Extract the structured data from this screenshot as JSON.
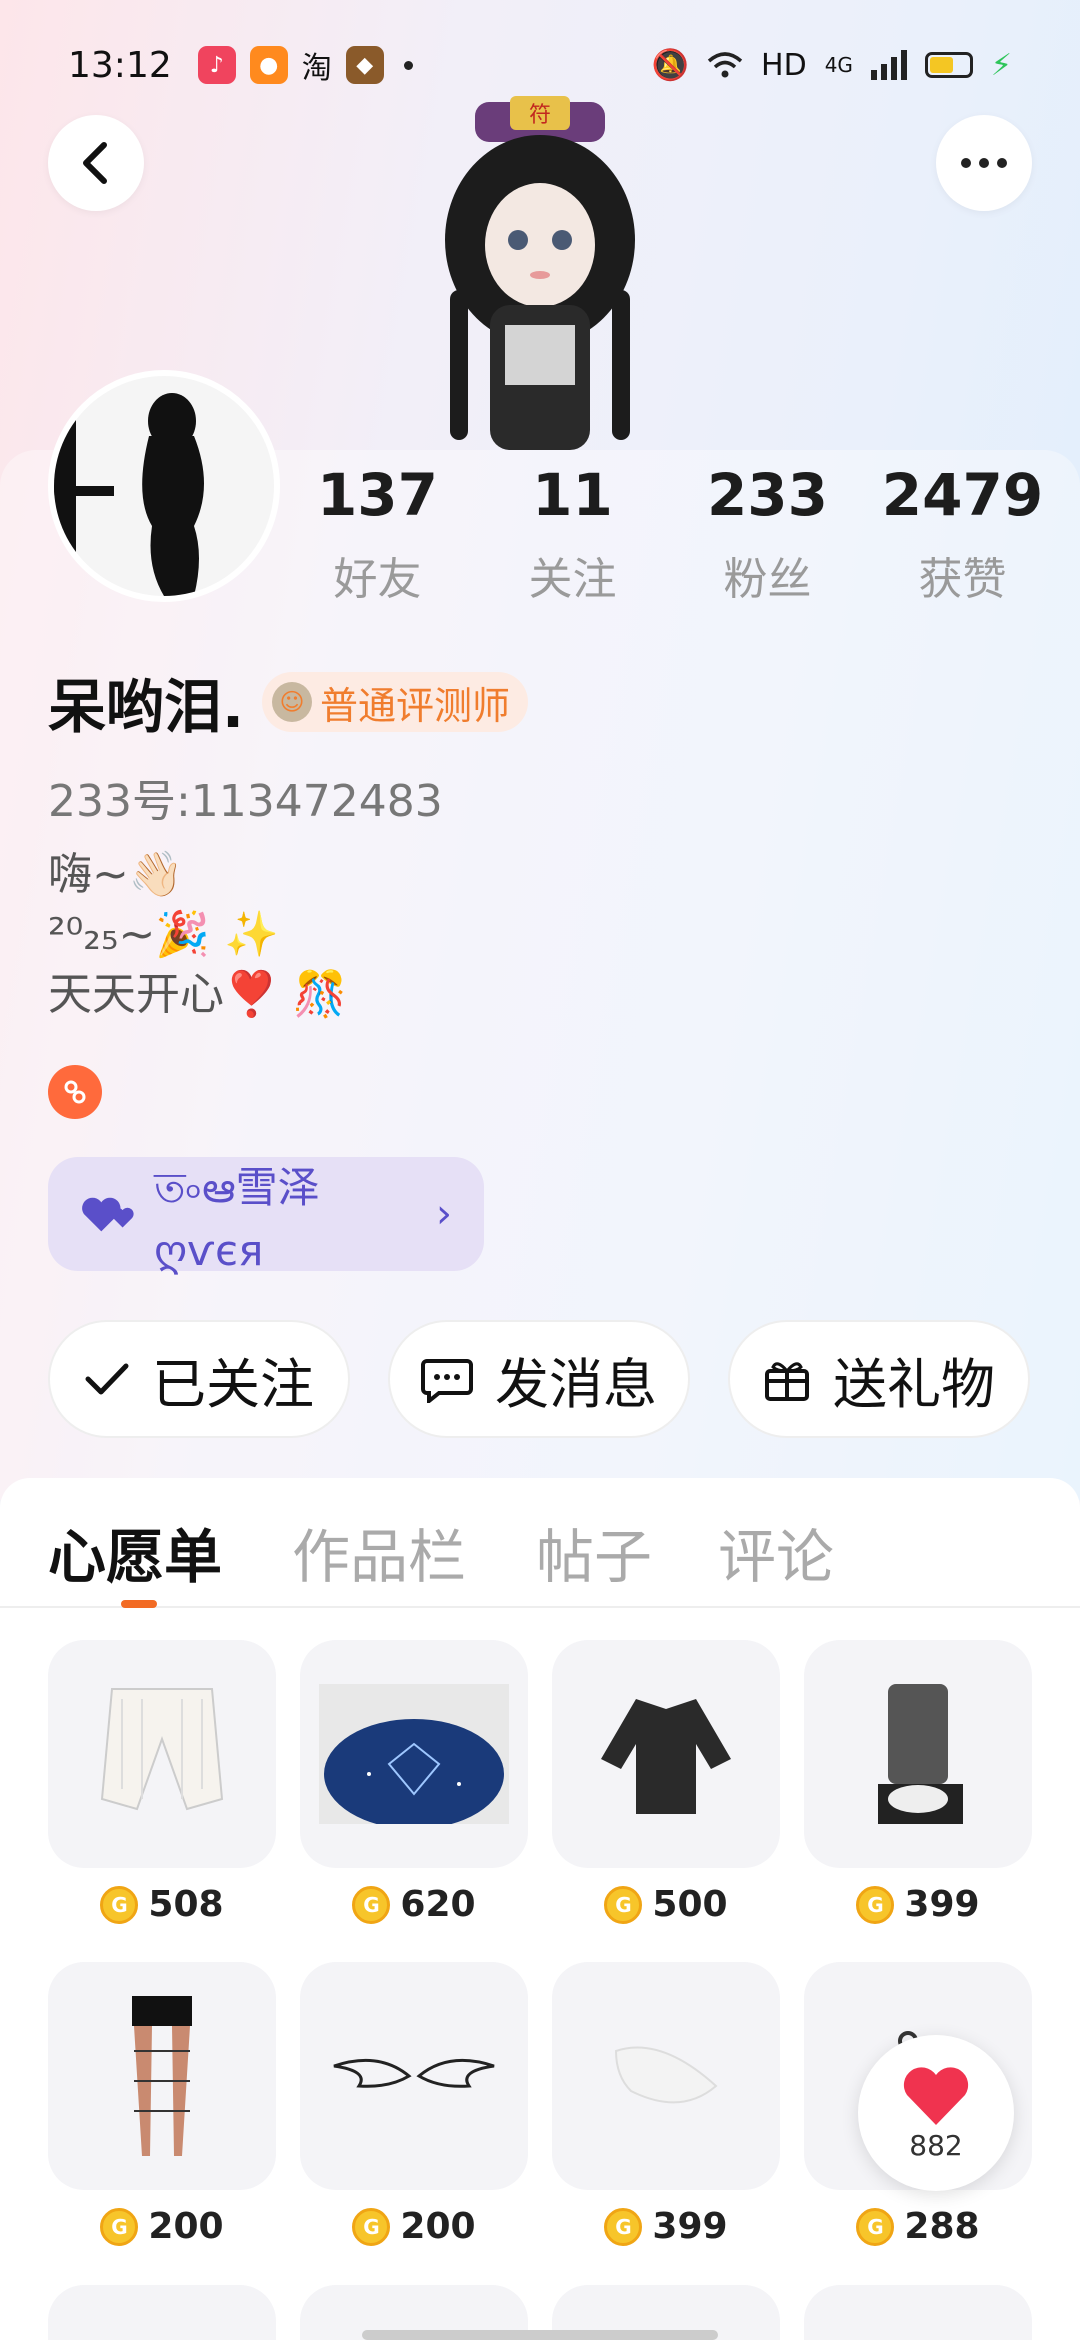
{
  "status_bar": {
    "time": "13:12",
    "network": "HD",
    "signal": "4G",
    "battery_color": "#f4c623",
    "taobao_label": "淘"
  },
  "profile": {
    "stats": [
      {
        "value": "137",
        "label": "好友"
      },
      {
        "value": "11",
        "label": "关注"
      },
      {
        "value": "233",
        "label": "粉丝"
      },
      {
        "value": "2479",
        "label": "获赞"
      }
    ],
    "name": "呆哟泪.",
    "badge_label": "普通评测师",
    "uid": "233号:113472483",
    "bio": [
      "嗨~👋🏻",
      "²⁰₂₅~🎉 ✨",
      "天天开心❣️ 🎊"
    ],
    "partner_label": "ত৹ఆ雪泽ღѵєя"
  },
  "actions": {
    "follow_label": "已关注",
    "message_label": "发消息",
    "gift_label": "送礼物"
  },
  "tabs": [
    {
      "label": "心愿单",
      "active": true
    },
    {
      "label": "作品栏",
      "active": false
    },
    {
      "label": "帖子",
      "active": false
    },
    {
      "label": "评论",
      "active": false
    }
  ],
  "wishlist": [
    {
      "price": "508",
      "icon": "bloomers-icon"
    },
    {
      "price": "620",
      "icon": "starry-stage-icon"
    },
    {
      "price": "500",
      "icon": "black-jacket-icon"
    },
    {
      "price": "399",
      "icon": "boots-icon"
    },
    {
      "price": "200",
      "icon": "fishnet-stockings-icon"
    },
    {
      "price": "200",
      "icon": "wings-icon"
    },
    {
      "price": "399",
      "icon": "white-feather-icon"
    },
    {
      "price": "288",
      "icon": "chain-icon"
    }
  ],
  "coin_symbol": "G",
  "like_count": "882",
  "accent_color": "#f26b24"
}
